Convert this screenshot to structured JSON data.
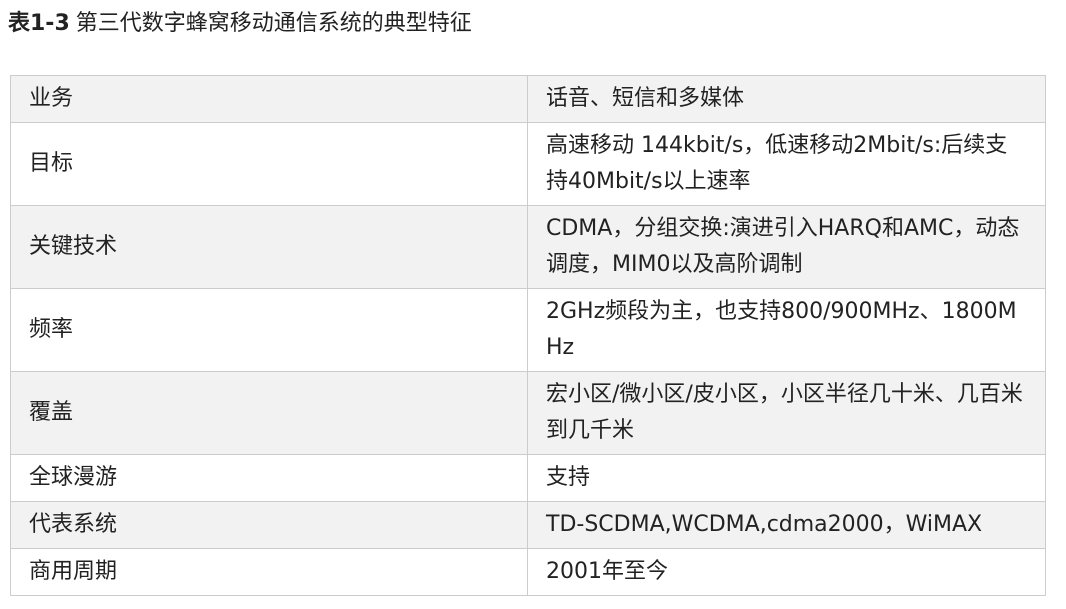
{
  "caption": {
    "number": "表1-3",
    "title": "第三代数字蜂窝移动通信系统的典型特征"
  },
  "table": {
    "rows": [
      {
        "label": "业务",
        "value": "话音、短信和多媒体"
      },
      {
        "label": "目标",
        "value": "高速移动 144kbit/s，低速移动2Mbit/s:后续支持40Mbit/s以上速率"
      },
      {
        "label": "关键技术",
        "value": "CDMA，分组交换:演进引入HARQ和AMC，动态调度，MIM0以及高阶调制"
      },
      {
        "label": "频率",
        "value": "2GHz频段为主，也支持800/900MHz、1800MHz"
      },
      {
        "label": "覆盖",
        "value": "宏小区/微小区/皮小区，小区半径几十米、几百米到几千米"
      },
      {
        "label": "全球漫游",
        "value": "支持"
      },
      {
        "label": "代表系统",
        "value": "TD-SCDMA,WCDMA,cdma2000，WiMAX"
      },
      {
        "label": "商用周期",
        "value": "2001年至今"
      }
    ]
  }
}
